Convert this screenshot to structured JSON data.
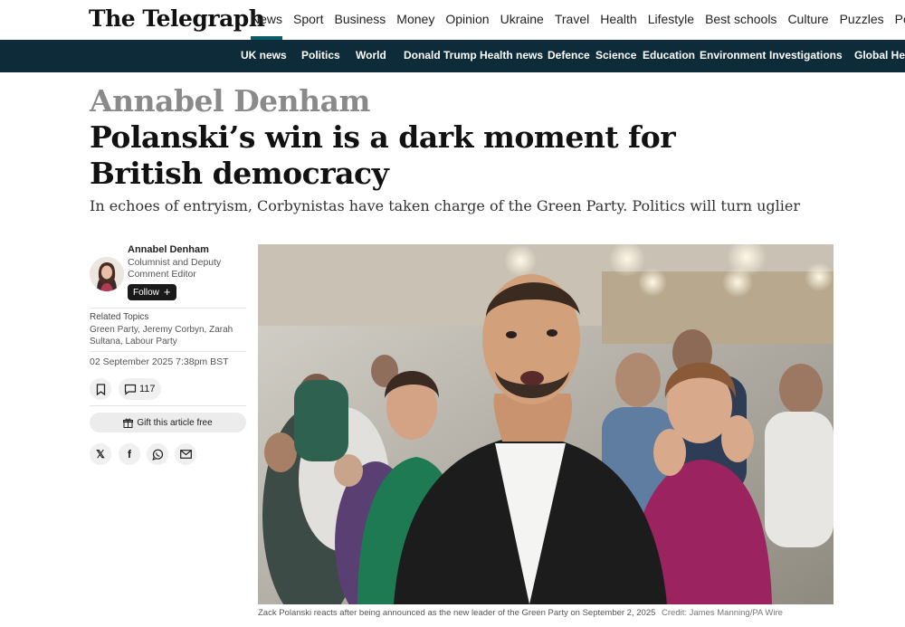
{
  "brand": {
    "logo_text": "The Telegraph"
  },
  "main_nav": [
    {
      "label": "News",
      "active": true
    },
    {
      "label": "Sport"
    },
    {
      "label": "Business"
    },
    {
      "label": "Money"
    },
    {
      "label": "Opinion"
    },
    {
      "label": "Ukraine"
    },
    {
      "label": "Travel"
    },
    {
      "label": "Health"
    },
    {
      "label": "Lifestyle"
    },
    {
      "label": "Best schools"
    },
    {
      "label": "Culture"
    },
    {
      "label": "Puzzles"
    },
    {
      "label": "Podcasts"
    }
  ],
  "sub_nav": [
    {
      "label": "UK news"
    },
    {
      "label": "Politics"
    },
    {
      "label": "World"
    },
    {
      "label": "Donald Trump"
    },
    {
      "label": "Health news"
    },
    {
      "label": "Defence"
    },
    {
      "label": "Science"
    },
    {
      "label": "Education"
    },
    {
      "label": "Environment"
    },
    {
      "label": "Investigations"
    },
    {
      "label": "Global Health Security"
    }
  ],
  "article": {
    "kicker": "Annabel Denham",
    "headline": "Polanski’s win is a dark moment for British democracy",
    "standfirst": "In echoes of entryism, Corbynistas have taken charge of the Green Party. Politics will turn uglier",
    "author": {
      "name": "Annabel Denham",
      "role": "Columnist and Deputy Comment Editor",
      "follow_label": "Follow"
    },
    "related_topics": {
      "title": "Related Topics",
      "items": [
        "Green Party",
        "Jeremy Corbyn",
        "Zarah Sultana",
        "Labour Party"
      ]
    },
    "date": "02 September 2025 7:38pm BST",
    "comment_count": "117",
    "gift_label": "Gift this article free",
    "share_icons": [
      "x-icon",
      "facebook-icon",
      "whatsapp-icon",
      "email-icon"
    ],
    "image": {
      "caption": "Zack Polanski reacts after being announced as the new leader of the Green Party on September 2, 2025",
      "credit": "Credit: James Manning/PA Wire"
    }
  },
  "colors": {
    "subnav_bg": "#0d2b39",
    "active_underline": "#0a5c67",
    "kicker": "#8a8a8a"
  }
}
